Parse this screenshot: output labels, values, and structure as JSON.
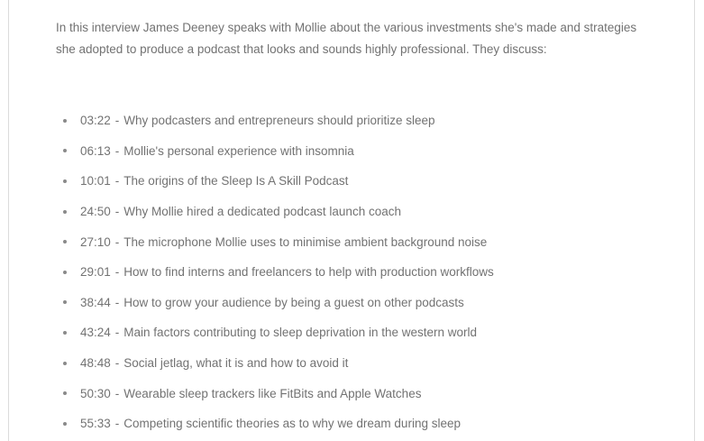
{
  "intro": {
    "text": "In this interview James Deeney speaks with Mollie about the various investments she's made and strategies she adopted to produce a podcast that looks and sounds highly professional. They discuss:"
  },
  "episodes": [
    {
      "time": "03:22",
      "topic": "Why podcasters and entrepreneurs should prioritize sleep"
    },
    {
      "time": "06:13",
      "topic": "Mollie's personal experience with insomnia"
    },
    {
      "time": "10:01",
      "topic": "The origins of the Sleep Is A Skill Podcast"
    },
    {
      "time": "24:50",
      "topic": "Why Mollie hired a dedicated podcast launch coach"
    },
    {
      "time": "27:10",
      "topic": "The microphone Mollie uses to minimise ambient background noise"
    },
    {
      "time": "29:01",
      "topic": "How to find interns and freelancers to help with production workflows"
    },
    {
      "time": "38:44",
      "topic": "How to grow your audience by being a guest on other podcasts"
    },
    {
      "time": "43:24",
      "topic": "Main factors contributing to sleep deprivation in the western world"
    },
    {
      "time": "48:48",
      "topic": "Social jetlag, what it is and how to avoid it"
    },
    {
      "time": "50:30",
      "topic": "Wearable sleep trackers like FitBits and Apple Watches"
    },
    {
      "time": "55:33",
      "topic": "Competing scientific theories as to why we dream during sleep"
    }
  ],
  "separator": "-"
}
